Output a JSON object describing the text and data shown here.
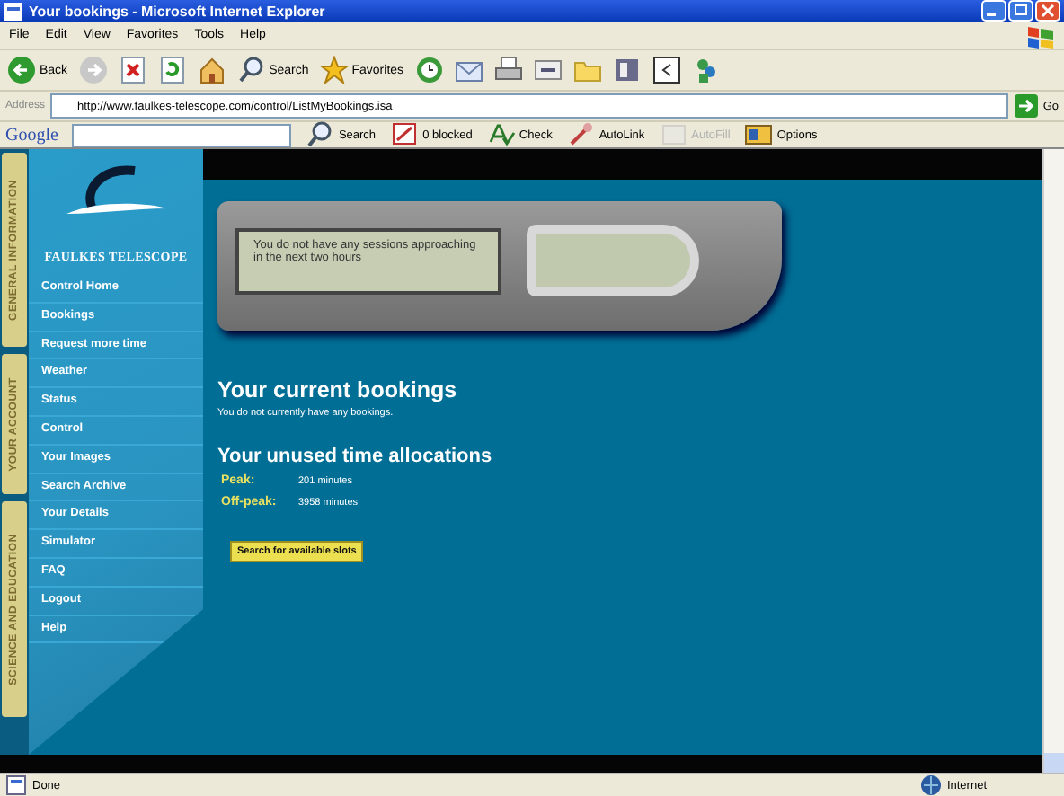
{
  "window": {
    "title": "Your bookings - Microsoft Internet Explorer"
  },
  "menu": [
    "File",
    "Edit",
    "View",
    "Favorites",
    "Tools",
    "Help"
  ],
  "toolbar": [
    {
      "kind": "back",
      "label": "Back"
    },
    {
      "kind": "forward"
    },
    {
      "kind": "stop"
    },
    {
      "kind": "refresh"
    },
    {
      "kind": "home"
    },
    {
      "kind": "search",
      "label": "Search"
    },
    {
      "kind": "favorites",
      "label": "Favorites"
    },
    {
      "kind": "history"
    },
    {
      "kind": "mail"
    },
    {
      "kind": "print"
    },
    {
      "kind": "edit"
    },
    {
      "kind": "folder"
    },
    {
      "kind": "research"
    },
    {
      "kind": "window"
    },
    {
      "kind": "messenger"
    }
  ],
  "address": {
    "label": "Address",
    "url": "http://www.faulkes-telescope.com/control/ListMyBookings.isa",
    "go": "Go"
  },
  "google_bar": {
    "logo": "Google",
    "items": [
      {
        "kind": "search",
        "label": "Search",
        "disabled": false
      },
      {
        "kind": "blocked",
        "label": "0 blocked",
        "disabled": false
      },
      {
        "kind": "check",
        "label": "Check",
        "disabled": false
      },
      {
        "kind": "autolink",
        "label": "AutoLink",
        "disabled": false
      },
      {
        "kind": "autofill",
        "label": "AutoFill",
        "disabled": true
      },
      {
        "kind": "options",
        "label": "Options",
        "disabled": false
      }
    ]
  },
  "sidebar": {
    "brand": "FAULKES TELESCOPE",
    "tabs": [
      "GENERAL INFORMATION",
      "YOUR ACCOUNT",
      "SCIENCE AND EDUCATION"
    ],
    "items": [
      "Control Home",
      "Bookings",
      "Request more time",
      "Weather",
      "Status",
      "Control",
      "Your Images",
      "Search Archive",
      "Your Details",
      "Simulator",
      "FAQ",
      "Logout",
      "Help"
    ]
  },
  "lcd": {
    "message": "You do not have any sessions approaching in the next two hours"
  },
  "bookings": {
    "heading": "Your current bookings",
    "text": "You do not currently have any bookings."
  },
  "allocations": {
    "heading": "Your unused time allocations",
    "rows": [
      {
        "label": "Peak:",
        "value": "201 minutes"
      },
      {
        "label": "Off-peak:",
        "value": "3958 minutes"
      }
    ]
  },
  "search_button": "Search for available slots",
  "status_bar": {
    "text": "Done",
    "zone": "Internet"
  }
}
